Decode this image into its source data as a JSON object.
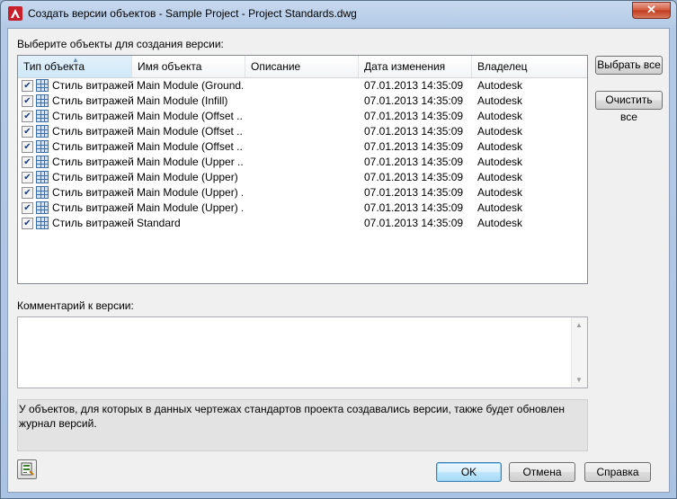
{
  "window": {
    "title": "Создать версии объектов - Sample Project - Project Standards.dwg"
  },
  "select_label": "Выберите объекты для создания версии:",
  "columns": [
    "Тип объекта",
    "Имя объекта",
    "Описание",
    "Дата изменения",
    "Владелец"
  ],
  "rows": [
    {
      "type": "Стиль витражей",
      "name": "Main Module (Ground...",
      "description": "",
      "date": "07.01.2013 14:35:09",
      "owner": "Autodesk",
      "checked": true
    },
    {
      "type": "Стиль витражей",
      "name": "Main Module (Infill)",
      "description": "",
      "date": "07.01.2013 14:35:09",
      "owner": "Autodesk",
      "checked": true
    },
    {
      "type": "Стиль витражей",
      "name": "Main Module (Offset ...",
      "description": "",
      "date": "07.01.2013 14:35:09",
      "owner": "Autodesk",
      "checked": true
    },
    {
      "type": "Стиль витражей",
      "name": "Main Module (Offset ...",
      "description": "",
      "date": "07.01.2013 14:35:09",
      "owner": "Autodesk",
      "checked": true
    },
    {
      "type": "Стиль витражей",
      "name": "Main Module (Offset ...",
      "description": "",
      "date": "07.01.2013 14:35:09",
      "owner": "Autodesk",
      "checked": true
    },
    {
      "type": "Стиль витражей",
      "name": "Main Module (Upper ...",
      "description": "",
      "date": "07.01.2013 14:35:09",
      "owner": "Autodesk",
      "checked": true
    },
    {
      "type": "Стиль витражей",
      "name": "Main Module (Upper)",
      "description": "",
      "date": "07.01.2013 14:35:09",
      "owner": "Autodesk",
      "checked": true
    },
    {
      "type": "Стиль витражей",
      "name": "Main Module (Upper) ...",
      "description": "",
      "date": "07.01.2013 14:35:09",
      "owner": "Autodesk",
      "checked": true
    },
    {
      "type": "Стиль витражей",
      "name": "Main Module (Upper) ...",
      "description": "",
      "date": "07.01.2013 14:35:09",
      "owner": "Autodesk",
      "checked": true
    },
    {
      "type": "Стиль витражей",
      "name": "Standard",
      "description": "",
      "date": "07.01.2013 14:35:09",
      "owner": "Autodesk",
      "checked": true
    }
  ],
  "buttons": {
    "select_all": "Выбрать все",
    "clear_all": "Очистить все",
    "ok": "OK",
    "cancel": "Отмена",
    "help": "Справка"
  },
  "comment_label": "Комментарий к версии:",
  "comment_value": "",
  "info_text": "У объектов, для которых в данных чертежах стандартов проекта создавались версии, также будет обновлен журнал версий.",
  "icons": {
    "app": "autocad-logo-icon",
    "row": "curtain-wall-style-icon",
    "tool": "version-history-icon"
  },
  "colors": {
    "titlebar": "#b3cae6",
    "close": "#c13b1d",
    "ok_border": "#3c7fb1"
  }
}
